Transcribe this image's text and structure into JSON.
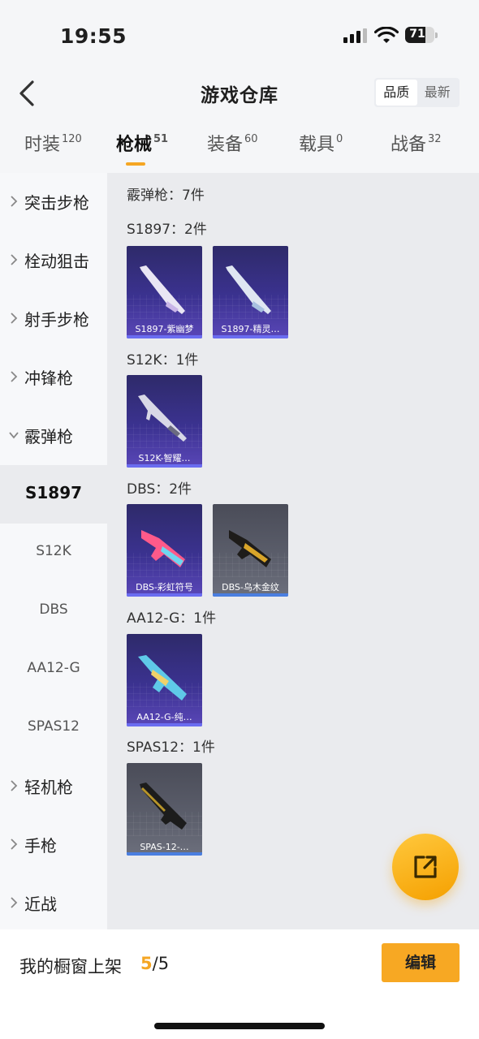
{
  "status_bar": {
    "time": "19:55",
    "battery": "71"
  },
  "header": {
    "title": "游戏仓库",
    "sort_options": [
      "品质",
      "最新"
    ],
    "sort_active": "品质"
  },
  "tabs": [
    {
      "label": "时装",
      "count": "120"
    },
    {
      "label": "枪械",
      "count": "51"
    },
    {
      "label": "装备",
      "count": "60"
    },
    {
      "label": "载具",
      "count": "0"
    },
    {
      "label": "战备",
      "count": "32"
    }
  ],
  "active_tab": "枪械",
  "sidebar": [
    {
      "label": "突击步枪",
      "type": "category",
      "expanded": false
    },
    {
      "label": "栓动狙击",
      "type": "category",
      "expanded": false
    },
    {
      "label": "射手步枪",
      "type": "category",
      "expanded": false
    },
    {
      "label": "冲锋枪",
      "type": "category",
      "expanded": false
    },
    {
      "label": "霰弹枪",
      "type": "category",
      "expanded": true
    },
    {
      "label": "S1897",
      "type": "sub",
      "selected": true
    },
    {
      "label": "S12K",
      "type": "sub"
    },
    {
      "label": "DBS",
      "type": "sub"
    },
    {
      "label": "AA12-G",
      "type": "sub"
    },
    {
      "label": "SPAS12",
      "type": "sub"
    },
    {
      "label": "轻机枪",
      "type": "category",
      "expanded": false
    },
    {
      "label": "手枪",
      "type": "category",
      "expanded": false
    },
    {
      "label": "近战",
      "type": "category",
      "expanded": false
    }
  ],
  "content": {
    "summary": "霰弹枪：7件",
    "groups": [
      {
        "title": "S1897：2件",
        "items": [
          {
            "name": "S1897-紫幽梦",
            "rarity": "purple"
          },
          {
            "name": "S1897-精灵…",
            "rarity": "purple"
          }
        ]
      },
      {
        "title": "S12K：1件",
        "items": [
          {
            "name": "S12K-智耀…",
            "rarity": "purple"
          }
        ]
      },
      {
        "title": "DBS：2件",
        "items": [
          {
            "name": "DBS-彩虹符号",
            "rarity": "purple"
          },
          {
            "name": "DBS-乌木金纹",
            "rarity": "grey"
          }
        ]
      },
      {
        "title": "AA12-G：1件",
        "items": [
          {
            "name": "AA12-G-纯…",
            "rarity": "purple"
          }
        ]
      },
      {
        "title": "SPAS12：1件",
        "items": [
          {
            "name": "SPAS-12-…",
            "rarity": "grey"
          }
        ]
      }
    ]
  },
  "bottom_bar": {
    "label": "我的橱窗上架",
    "current": "5",
    "total": "/5",
    "edit_label": "编辑"
  },
  "colors": {
    "accent": "#f5a623",
    "purple_card": "#3b3290",
    "grey_card": "#5c5f6c"
  },
  "icons": [
    "back-icon",
    "chevron-right-icon",
    "chevron-down-icon",
    "share-icon"
  ]
}
